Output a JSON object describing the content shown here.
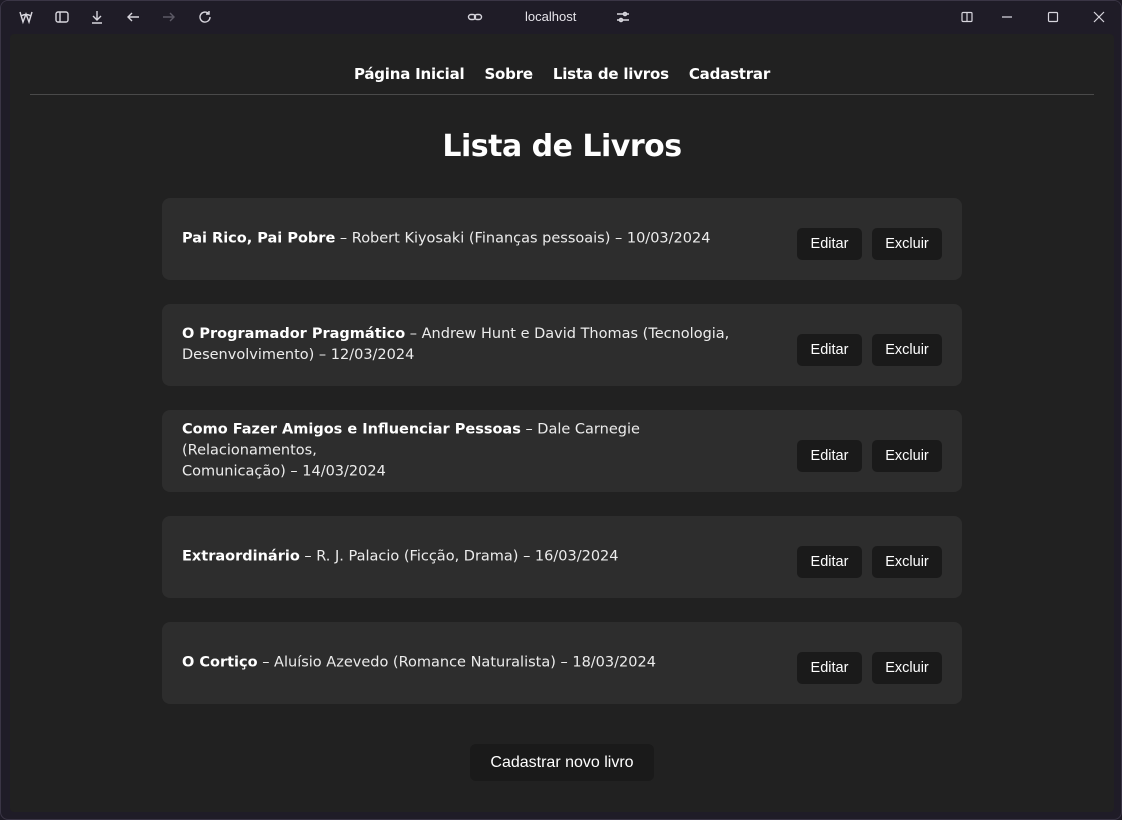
{
  "browser": {
    "url": "localhost"
  },
  "nav": {
    "items": [
      "Página Inicial",
      "Sobre",
      "Lista de livros",
      "Cadastrar"
    ]
  },
  "page": {
    "title": "Lista de Livros"
  },
  "books": [
    {
      "title": "Pai Rico, Pai Pobre",
      "line1": " – Robert Kiyosaki (Finanças pessoais) – 10/03/2024",
      "line2": ""
    },
    {
      "title": "O Programador Pragmático",
      "line1": " – Andrew Hunt e David Thomas (Tecnologia,",
      "line2": "Desenvolvimento) – 12/03/2024"
    },
    {
      "title": "Como Fazer Amigos e Influenciar Pessoas",
      "line1": " – Dale Carnegie (Relacionamentos,",
      "line2": "Comunicação) – 14/03/2024"
    },
    {
      "title": "Extraordinário",
      "line1": " – R. J. Palacio (Ficção, Drama) – 16/03/2024",
      "line2": ""
    },
    {
      "title": "O Cortiço",
      "line1": " – Aluísio Azevedo (Romance Naturalista) – 18/03/2024",
      "line2": ""
    }
  ],
  "actions": {
    "edit_label": "Editar",
    "delete_label": "Excluir",
    "new_book_label": "Cadastrar novo livro"
  }
}
